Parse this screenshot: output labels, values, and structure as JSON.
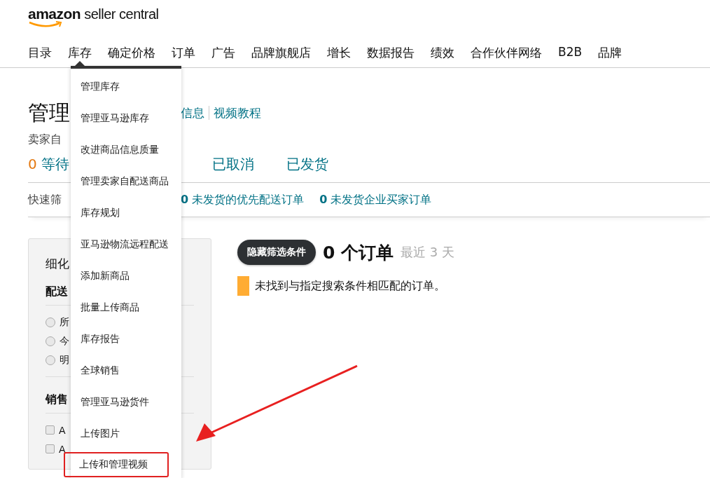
{
  "header": {
    "logo_brand": "amazon",
    "logo_product": "seller central"
  },
  "nav": [
    {
      "label": "目录",
      "selected": false
    },
    {
      "label": "库存",
      "selected": true
    },
    {
      "label": "确定价格",
      "selected": false
    },
    {
      "label": "订单",
      "selected": false
    },
    {
      "label": "广告",
      "selected": false
    },
    {
      "label": "品牌旗舰店",
      "selected": false
    },
    {
      "label": "增长",
      "selected": false
    },
    {
      "label": "数据报告",
      "selected": false
    },
    {
      "label": "绩效",
      "selected": false
    },
    {
      "label": "合作伙伴网络",
      "selected": false
    },
    {
      "label": "B2B",
      "selected": false
    },
    {
      "label": "品牌",
      "selected": false
    }
  ],
  "dropdown": {
    "items": [
      {
        "label": "管理库存",
        "highlighted": false
      },
      {
        "label": "管理亚马逊库存",
        "highlighted": false
      },
      {
        "label": "改进商品信息质量",
        "highlighted": false
      },
      {
        "label": "管理卖家自配送商品",
        "highlighted": false
      },
      {
        "label": "库存规划",
        "highlighted": false
      },
      {
        "label": "亚马逊物流远程配送",
        "highlighted": false
      },
      {
        "label": "添加新商品",
        "highlighted": false
      },
      {
        "label": "批量上传商品",
        "highlighted": false
      },
      {
        "label": "库存报告",
        "highlighted": false
      },
      {
        "label": "全球销售",
        "highlighted": false
      },
      {
        "label": "管理亚马逊货件",
        "highlighted": false
      },
      {
        "label": "上传图片",
        "highlighted": false
      },
      {
        "label": "上传和管理视频",
        "highlighted": true
      }
    ]
  },
  "page": {
    "title": "管理",
    "links": [
      "信息",
      "视频教程"
    ],
    "subtitle": "卖家自",
    "tabs": [
      {
        "count": "0",
        "label": "等待"
      },
      {
        "label": "已取消"
      },
      {
        "label": "已发货"
      }
    ],
    "quick_filter": {
      "label": "快速筛",
      "items": [
        {
          "count": "0",
          "label": "未发货的优先配送订单"
        },
        {
          "count": "0",
          "label": "未发货企业买家订单"
        }
      ]
    }
  },
  "sidebar": {
    "title": "细化",
    "sections": [
      {
        "heading": "配送",
        "kind": "radio",
        "options": [
          {
            "label": "所",
            "checked": false
          },
          {
            "label": "今",
            "checked": false
          },
          {
            "label": "明",
            "checked": false
          }
        ]
      },
      {
        "heading": "销售",
        "kind": "checkbox",
        "options": [
          {
            "label": "A",
            "checked": false
          },
          {
            "label": "A",
            "checked": false
          }
        ]
      }
    ]
  },
  "results": {
    "toggle_button": "隐藏筛选条件",
    "count": "0 个订单",
    "range": "最近 3 天",
    "notice": "未找到与指定搜索条件相匹配的订单。"
  }
}
